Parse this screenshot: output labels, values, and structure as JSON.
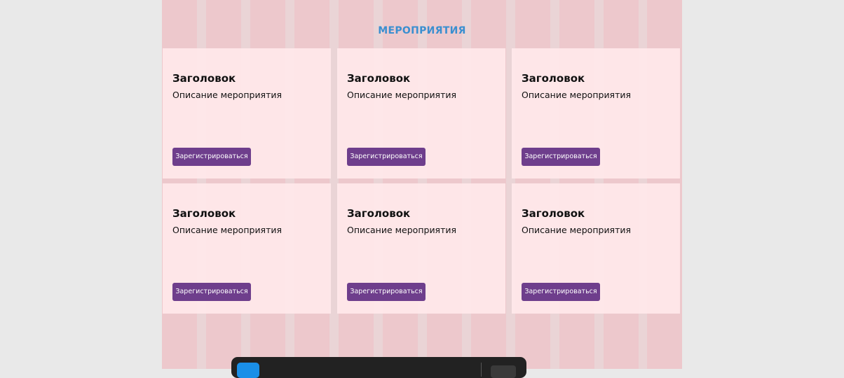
{
  "section": {
    "title": "МЕРОПРИЯТИЯ"
  },
  "cards": [
    {
      "title": "Заголовок",
      "description": "Описание мероприятия",
      "button": "Зарегистрироваться"
    },
    {
      "title": "Заголовок",
      "description": "Описание мероприятия",
      "button": "Зарегистрироваться"
    },
    {
      "title": "Заголовок",
      "description": "Описание мероприятия",
      "button": "Зарегистрироваться"
    },
    {
      "title": "Заголовок",
      "description": "Описание мероприятия",
      "button": "Зарегистрироваться"
    },
    {
      "title": "Заголовок",
      "description": "Описание мероприятия",
      "button": "Зарегистрироваться"
    },
    {
      "title": "Заголовок",
      "description": "Описание мероприятия",
      "button": "Зарегистрироваться"
    }
  ],
  "colors": {
    "background": "#e9e9e9",
    "section_title": "#3a8fd0",
    "card_background": "#ffe8ea",
    "button": "#6e3e8c",
    "grid_overlay": "#ff96a0",
    "taskbar": "#222222",
    "taskbar_accent": "#1a8fe8"
  },
  "taskbar": {
    "app_icon": "app-icon"
  }
}
